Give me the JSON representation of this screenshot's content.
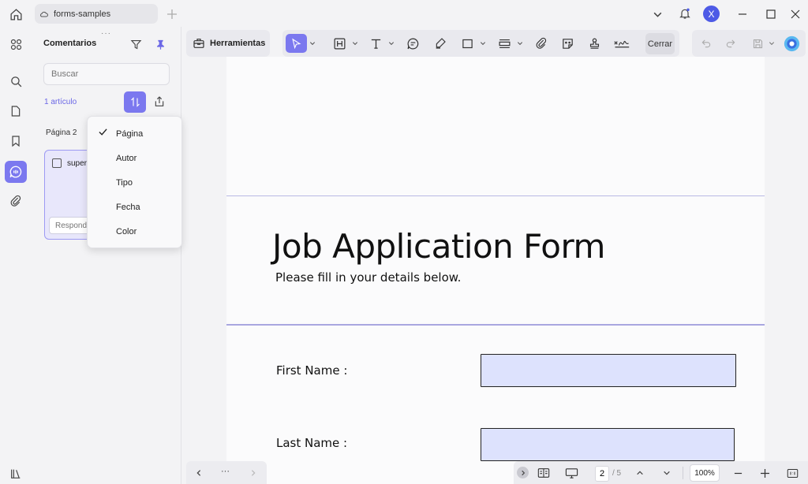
{
  "titlebar": {
    "tab_label": "forms-samples",
    "avatar_letter": "X"
  },
  "comments_panel": {
    "title": "Comentarios",
    "search_placeholder": "Buscar",
    "count_label": "1 artículo",
    "page_group": "Página 2",
    "comment_text": "super",
    "reply_placeholder": "Respond",
    "sort_menu": {
      "items": [
        "Página",
        "Autor",
        "Tipo",
        "Fecha",
        "Color"
      ],
      "selected": "Página"
    }
  },
  "toolbar": {
    "tools_label": "Herramientas",
    "close_label": "Cerrar"
  },
  "document": {
    "title": "Job Application Form",
    "subtitle": "Please fill in your details below.",
    "first_name_label": "First Name :",
    "last_name_label": "Last Name :"
  },
  "status": {
    "page_current": "2",
    "page_total": "/ 5",
    "zoom": "100%",
    "nav_more": "···"
  },
  "colors": {
    "accent": "#7b78ef",
    "avatar": "#4d5ae6",
    "field_fill": "#dde2fd",
    "divider": "#b9b8e4"
  }
}
